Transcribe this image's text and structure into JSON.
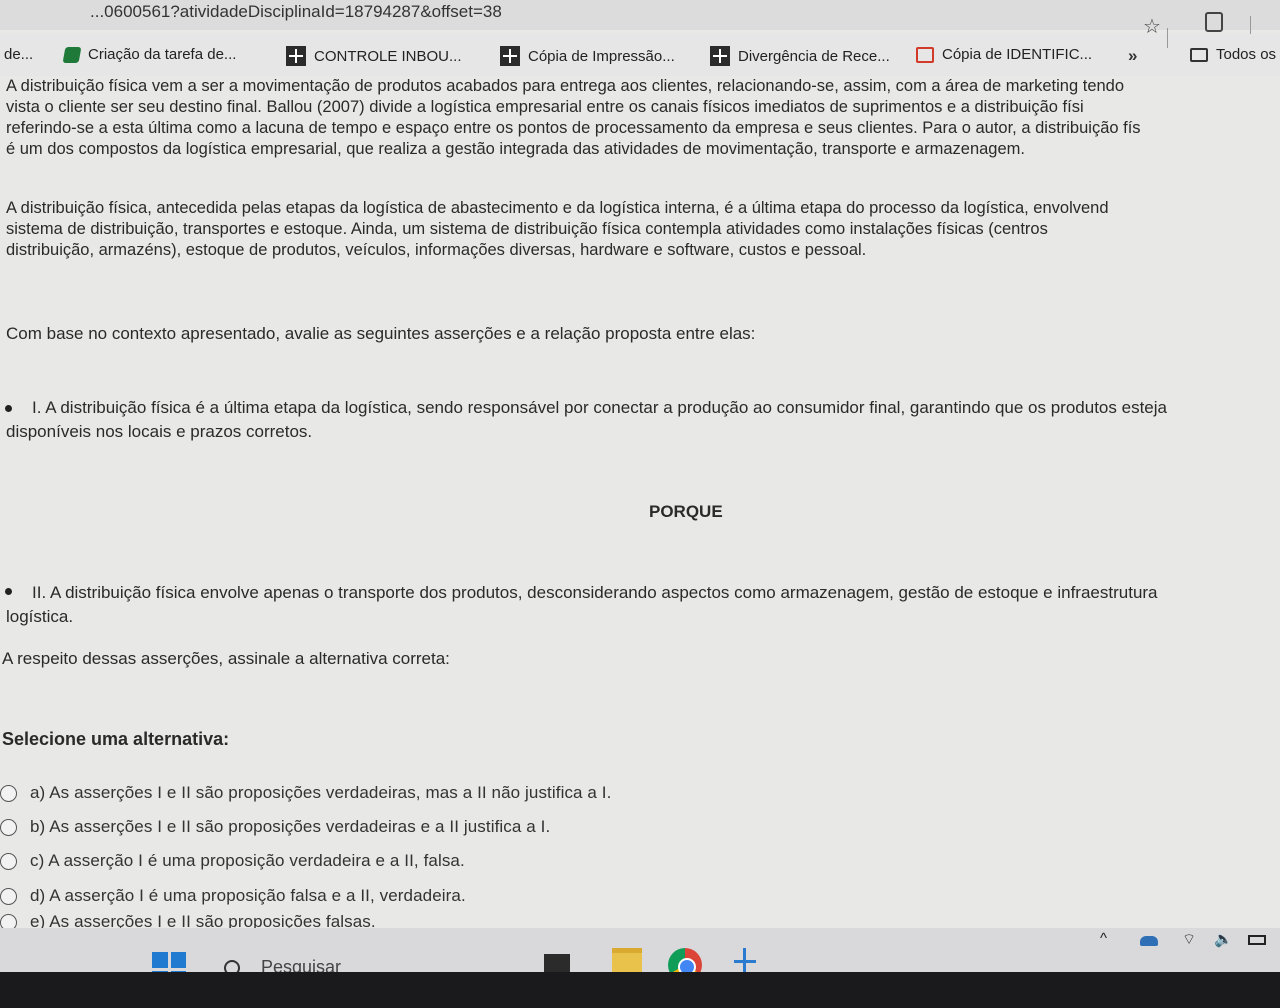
{
  "browser": {
    "url": "...0600561?atividadeDisciplinaId=18794287&offset=38"
  },
  "bookmarks": {
    "items": [
      {
        "label": "de...",
        "icon": "bookmark-icon"
      },
      {
        "label": "Criação da tarefa de...",
        "icon": "spreadsheet-icon"
      },
      {
        "label": "CONTROLE INBOU...",
        "icon": "plus-doc-icon"
      },
      {
        "label": "Cópia de Impressão...",
        "icon": "plus-doc-icon"
      },
      {
        "label": "Divergência de Rece...",
        "icon": "plus-doc-icon"
      },
      {
        "label": "Cópia de IDENTIFIC...",
        "icon": "red-doc-icon"
      }
    ],
    "more": "»",
    "all_label": "Todos os"
  },
  "question": {
    "para1": [
      "A distribuição física vem a ser a movimentação de produtos acabados para entrega aos clientes, relacionando-se, assim, com a área de marketing tendo",
      "vista o cliente ser seu destino final. Ballou (2007) divide a logística empresarial entre os canais físicos imediatos de suprimentos e a distribuição físi",
      "referindo-se a esta última como a lacuna de tempo e espaço entre os pontos de processamento da empresa e seus clientes. Para o autor, a distribuição fís",
      "é um dos compostos da logística empresarial, que realiza a gestão integrada das atividades de movimentação, transporte e armazenagem."
    ],
    "para2": [
      "A distribuição física, antecedida pelas etapas da logística de abastecimento e da logística interna, é a última etapa do processo da logística, envolvend",
      "sistema de distribuição, transportes e estoque. Ainda, um sistema de distribuição física contempla atividades como instalações físicas (centros",
      "distribuição, armazéns), estoque de produtos, veículos, informações diversas, hardware e software, custos e pessoal."
    ],
    "context_prompt": "Com base no contexto apresentado, avalie as seguintes asserções e a relação proposta entre elas:",
    "assertion1": [
      "I. A distribuição física é a última etapa da logística, sendo responsável por conectar a produção ao consumidor final, garantindo que os produtos esteja",
      "disponíveis nos locais e prazos corretos."
    ],
    "porque": "PORQUE",
    "assertion2": [
      "II. A distribuição física envolve apenas o transporte dos produtos, desconsiderando aspectos como armazenagem, gestão de estoque e infraestrutura",
      "logística."
    ],
    "instruction": "A respeito dessas asserções, assinale a alternativa correta:"
  },
  "alternatives": {
    "title": "Selecione uma alternativa:",
    "options": [
      "a) As asserções I e II são proposições verdadeiras, mas a II não justifica a I.",
      "b) As asserções I e II são proposições verdadeiras e a II justifica a I.",
      "c) A asserção I é uma proposição verdadeira e a II, falsa.",
      "d) A asserção I é uma proposição falsa e a II, verdadeira.",
      "e) As asserções I e II são proposições falsas."
    ]
  },
  "taskbar": {
    "search_label": "Pesquisar"
  }
}
